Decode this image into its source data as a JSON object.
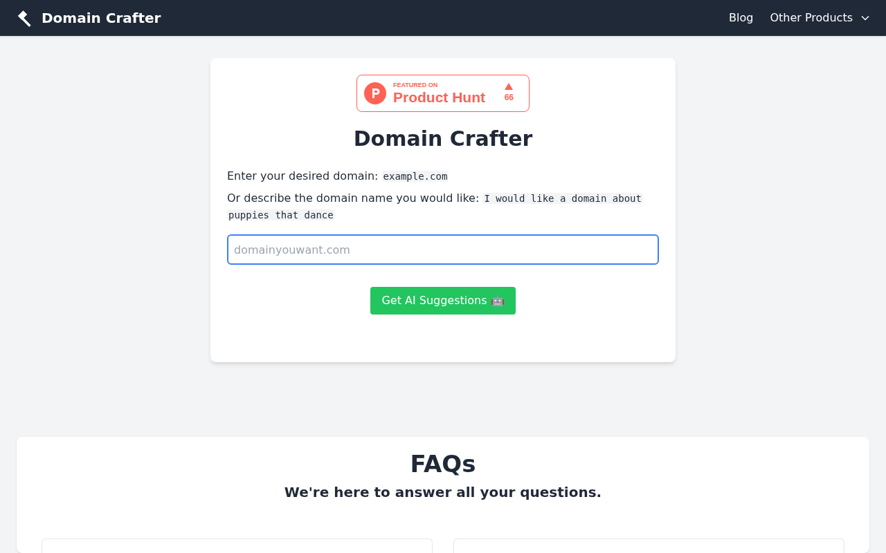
{
  "navbar": {
    "brand": "Domain Crafter",
    "links": [
      {
        "label": "Blog",
        "kind": "link"
      },
      {
        "label": "Other Products",
        "kind": "dropdown"
      }
    ]
  },
  "badge": {
    "kicker": "FEATURED ON",
    "name": "Product Hunt",
    "votes": "66"
  },
  "card": {
    "title": "Domain Crafter",
    "instructions": [
      {
        "text": "Enter your desired domain:",
        "example_lines": [
          "example.com"
        ]
      },
      {
        "text": "Or describe the domain name you would like:",
        "example_lines": [
          "I would like a domain about",
          "puppies that dance"
        ]
      }
    ],
    "input": {
      "placeholder": "domainyouwant.com",
      "focused": true
    },
    "button": "Get AI Suggestions 🤖"
  },
  "faq": {
    "title": "FAQs",
    "subtitle": "We're here to answer all your questions."
  }
}
